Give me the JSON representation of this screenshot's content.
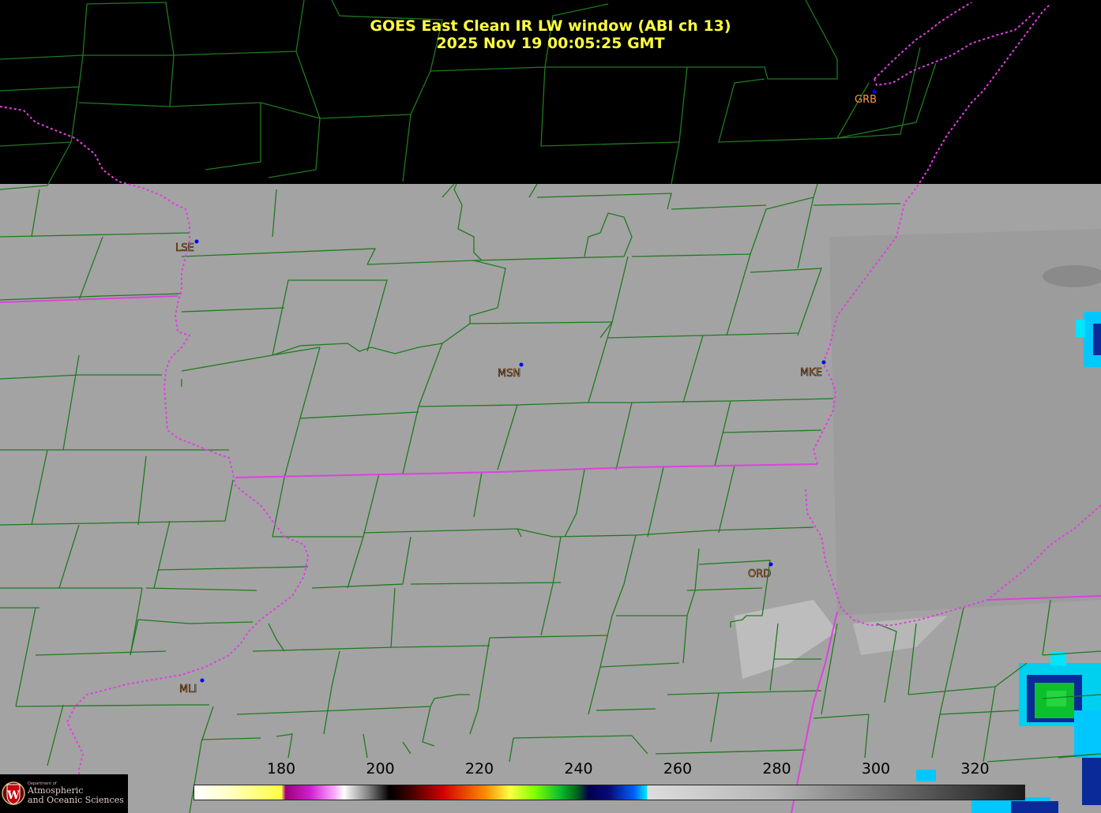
{
  "title": {
    "line1": "GOES East Clean IR LW window (ABI ch 13)",
    "line2": "2025 Nov 19  00:05:25 GMT"
  },
  "stations": [
    {
      "code": "GRB"
    },
    {
      "code": "LSE"
    },
    {
      "code": "MSN"
    },
    {
      "code": "MKE"
    },
    {
      "code": "ORD"
    },
    {
      "code": "MLI"
    }
  ],
  "colorbar": {
    "ticks": [
      "180",
      "200",
      "220",
      "240",
      "260",
      "280",
      "300",
      "320"
    ],
    "colors": {
      "warm_gray_end": "#b5b5b5",
      "cold_gray_end": "#1a1a1a",
      "cyan": "#00e5ff",
      "navy": "#0a0a7a",
      "green": "#0dbf2d",
      "yellow": "#ffff40",
      "red": "#d40000",
      "magenta": "#d020d0",
      "white": "#ffffff"
    }
  },
  "legend_colors": {
    "county_lines": "#1f7a1f",
    "state_lines": "#e040e0",
    "cloud_free_land": "#a3a3a3",
    "cold_cloud": "#0dbf2d"
  },
  "logo": {
    "dept": "Department of",
    "line1": "Atmospheric",
    "line2": "and Oceanic Sciences",
    "shield_letter": "W"
  }
}
